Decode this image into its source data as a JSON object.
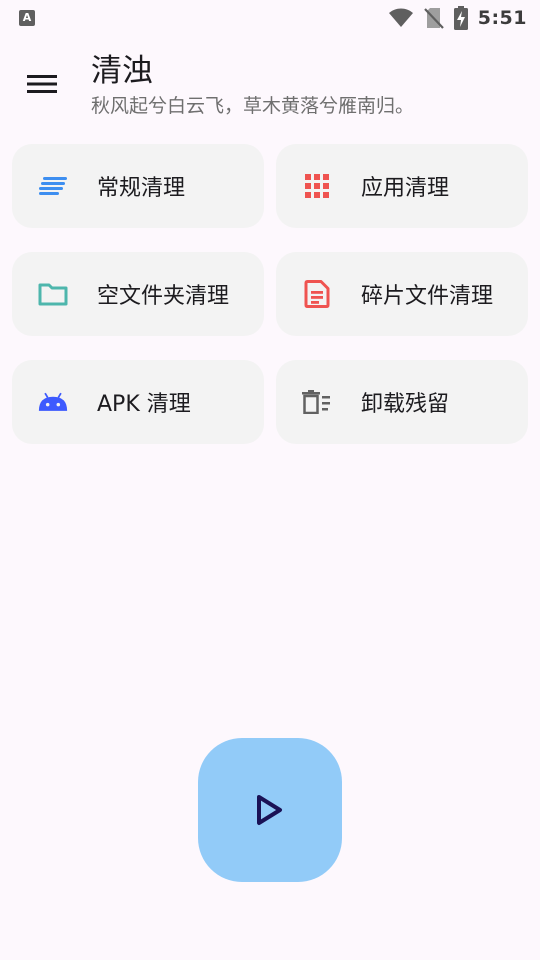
{
  "status_bar": {
    "left_icon": "A",
    "time": "5:51",
    "icons": [
      "wifi-icon",
      "no-sim-icon",
      "battery-charging-icon"
    ]
  },
  "app_bar": {
    "menu_icon": "menu-icon",
    "title": "清浊",
    "subtitle": "秋风起兮白云飞，草木黄落兮雁南归。"
  },
  "cards": [
    {
      "label": "常规清理",
      "icon": "general-clean-icon",
      "color": "#3d8ef0"
    },
    {
      "label": "应用清理",
      "icon": "app-grid-icon",
      "color": "#ef5350"
    },
    {
      "label": "空文件夹清理",
      "icon": "folder-icon",
      "color": "#4db6ac"
    },
    {
      "label": "碎片文件清理",
      "icon": "document-icon",
      "color": "#ef5350"
    },
    {
      "label": "APK 清理",
      "icon": "android-icon",
      "color": "#3d5afe"
    },
    {
      "label": "卸载残留",
      "icon": "trash-list-icon",
      "color": "#616161"
    }
  ],
  "fab": {
    "icon": "play-icon",
    "background": "#92cbf8",
    "icon_color": "#1a1256"
  }
}
